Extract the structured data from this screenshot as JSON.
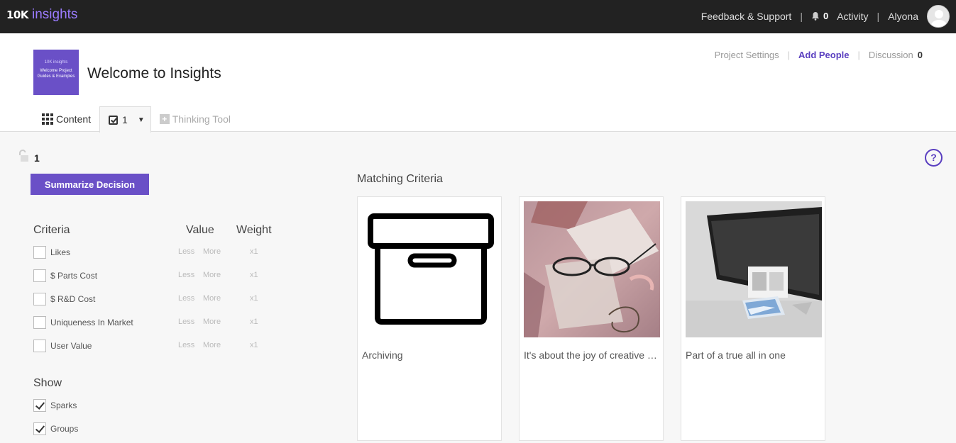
{
  "topbar": {
    "brand_mark": "10K",
    "brand_name": "insights",
    "feedback_label": "Feedback & Support",
    "notifications_count": "0",
    "activity_label": "Activity",
    "user_name": "Alyona"
  },
  "project": {
    "thumbnail_logo": "10K insights",
    "thumbnail_text": "Welcome Project Guides & Examples",
    "title": "Welcome to Insights",
    "links": {
      "settings": "Project Settings",
      "add_people": "Add People",
      "discussion": "Discussion",
      "discussion_count": "0"
    }
  },
  "tabs": {
    "content": "Content",
    "decision": "1",
    "thinking_tool": "Thinking Tool"
  },
  "decision": {
    "number": "1",
    "summarize_label": "Summarize Decision",
    "headers": {
      "criteria": "Criteria",
      "value": "Value",
      "weight": "Weight"
    },
    "criteria": [
      {
        "label": "Likes",
        "less": "Less",
        "more": "More",
        "weight": "x1",
        "checked": false
      },
      {
        "label": "$ Parts Cost",
        "less": "Less",
        "more": "More",
        "weight": "x1",
        "checked": false
      },
      {
        "label": "$ R&D Cost",
        "less": "Less",
        "more": "More",
        "weight": "x1",
        "checked": false
      },
      {
        "label": "Uniqueness In Market",
        "less": "Less",
        "more": "More",
        "weight": "x1",
        "checked": false
      },
      {
        "label": "User Value",
        "less": "Less",
        "more": "More",
        "weight": "x1",
        "checked": false
      }
    ],
    "show": {
      "header": "Show",
      "options": [
        {
          "label": "Sparks",
          "checked": true
        },
        {
          "label": "Groups",
          "checked": true
        }
      ]
    }
  },
  "matching": {
    "title": "Matching Criteria",
    "help": "?",
    "cards": [
      {
        "caption": "Archiving",
        "image": "archive-box-icon"
      },
      {
        "caption": "It's about the joy of creative process",
        "image": "glasses-photo"
      },
      {
        "caption": "Part of a true all in one",
        "image": "monitor-photo"
      }
    ]
  },
  "colors": {
    "accent": "#6a50c7",
    "topbar": "#222222",
    "brand": "#9b7bff"
  }
}
